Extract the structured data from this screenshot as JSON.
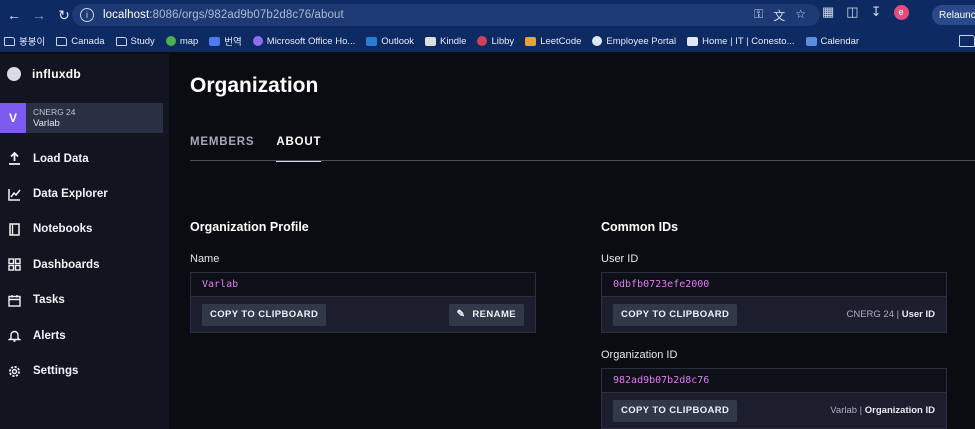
{
  "browser": {
    "url_host": "localhost",
    "url_path": ":8086/orgs/982ad9b07b2d8c76/about",
    "relaunch_label": "Relaunch",
    "profile_initial": "e",
    "bookmarks": [
      {
        "label": "봉봉이",
        "icon": "folder"
      },
      {
        "label": "Canada",
        "icon": "folder"
      },
      {
        "label": "Study",
        "icon": "folder"
      },
      {
        "label": "map",
        "icon": "map-pin",
        "color": "#4caf50"
      },
      {
        "label": "번역",
        "icon": "translate",
        "color": "#4b7bec"
      },
      {
        "label": "Microsoft Office Ho...",
        "icon": "office",
        "color": "#8f6cf0"
      },
      {
        "label": "Outlook",
        "icon": "outlook",
        "color": "#2b7cd3"
      },
      {
        "label": "Kindle",
        "icon": "kindle",
        "color": "#dddddd"
      },
      {
        "label": "Libby",
        "icon": "libby",
        "color": "#d23f5b"
      },
      {
        "label": "LeetCode",
        "icon": "leetcode",
        "color": "#f0a030"
      },
      {
        "label": "Employee Portal",
        "icon": "globe",
        "color": "#dfe6f5"
      },
      {
        "label": "Home | IT | Conesto...",
        "icon": "page",
        "color": "#dfe6f5"
      },
      {
        "label": "Calendar",
        "icon": "calendar",
        "color": "#5a8de0"
      }
    ]
  },
  "sidebar": {
    "brand": "influxdb",
    "org": {
      "initial": "V",
      "name": "CNERG 24",
      "user": "Varlab"
    },
    "items": [
      {
        "label": "Load Data",
        "icon": "upload-icon"
      },
      {
        "label": "Data Explorer",
        "icon": "graph-icon"
      },
      {
        "label": "Notebooks",
        "icon": "notebook-icon"
      },
      {
        "label": "Dashboards",
        "icon": "dashboard-icon"
      },
      {
        "label": "Tasks",
        "icon": "calendar-icon"
      },
      {
        "label": "Alerts",
        "icon": "bell-icon"
      },
      {
        "label": "Settings",
        "icon": "gear-icon"
      }
    ]
  },
  "main": {
    "title": "Organization",
    "tabs": [
      {
        "label": "MEMBERS",
        "active": false
      },
      {
        "label": "ABOUT",
        "active": true
      }
    ],
    "profile": {
      "section_title": "Organization Profile",
      "name_label": "Name",
      "name_value": "Varlab",
      "copy_label": "COPY TO CLIPBOARD",
      "rename_label": "RENAME"
    },
    "common_ids": {
      "section_title": "Common IDs",
      "user_id_label": "User ID",
      "user_id_value": "0dbfb0723efe2000",
      "user_copy_label": "COPY TO CLIPBOARD",
      "user_meta_owner": "CNERG 24",
      "user_meta_kind": "User ID",
      "org_id_label": "Organization ID",
      "org_id_value": "982ad9b07b2d8c76",
      "org_copy_label": "COPY TO CLIPBOARD",
      "org_meta_owner": "Varlab",
      "org_meta_kind": "Organization ID"
    }
  }
}
